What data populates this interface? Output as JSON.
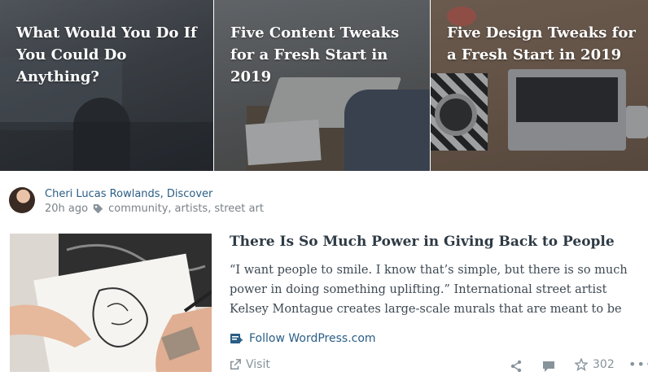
{
  "hero_cards": [
    {
      "title": "What Would You Do If You Could Do Anything?"
    },
    {
      "title": "Five Content Tweaks for a Fresh Start in 2019"
    },
    {
      "title": "Five Design Tweaks for a Fresh Start in 2019"
    }
  ],
  "post": {
    "author": "Cheri Lucas Rowlands",
    "site": "Discover",
    "time": "20h ago",
    "tags": [
      "community",
      "artists",
      "street art"
    ],
    "title": "There Is So Much Power in Giving Back to People",
    "excerpt": "“I want people to smile. I know that’s simple, but there is so much power in doing something uplifting.” International street artist Kelsey Montague creates large-scale murals that are meant to be",
    "follow_label": "Follow WordPress.com",
    "visit_label": "Visit",
    "like_count": "302"
  },
  "colors": {
    "link": "#2a5e86",
    "muted": "#87939b",
    "title": "#2e3a44"
  },
  "icons": {
    "tag": "tag-icon",
    "follow": "follow-site-icon",
    "visit": "external-link-icon",
    "share": "share-icon",
    "comment": "comment-icon",
    "like": "star-icon",
    "more": "ellipsis-icon"
  }
}
